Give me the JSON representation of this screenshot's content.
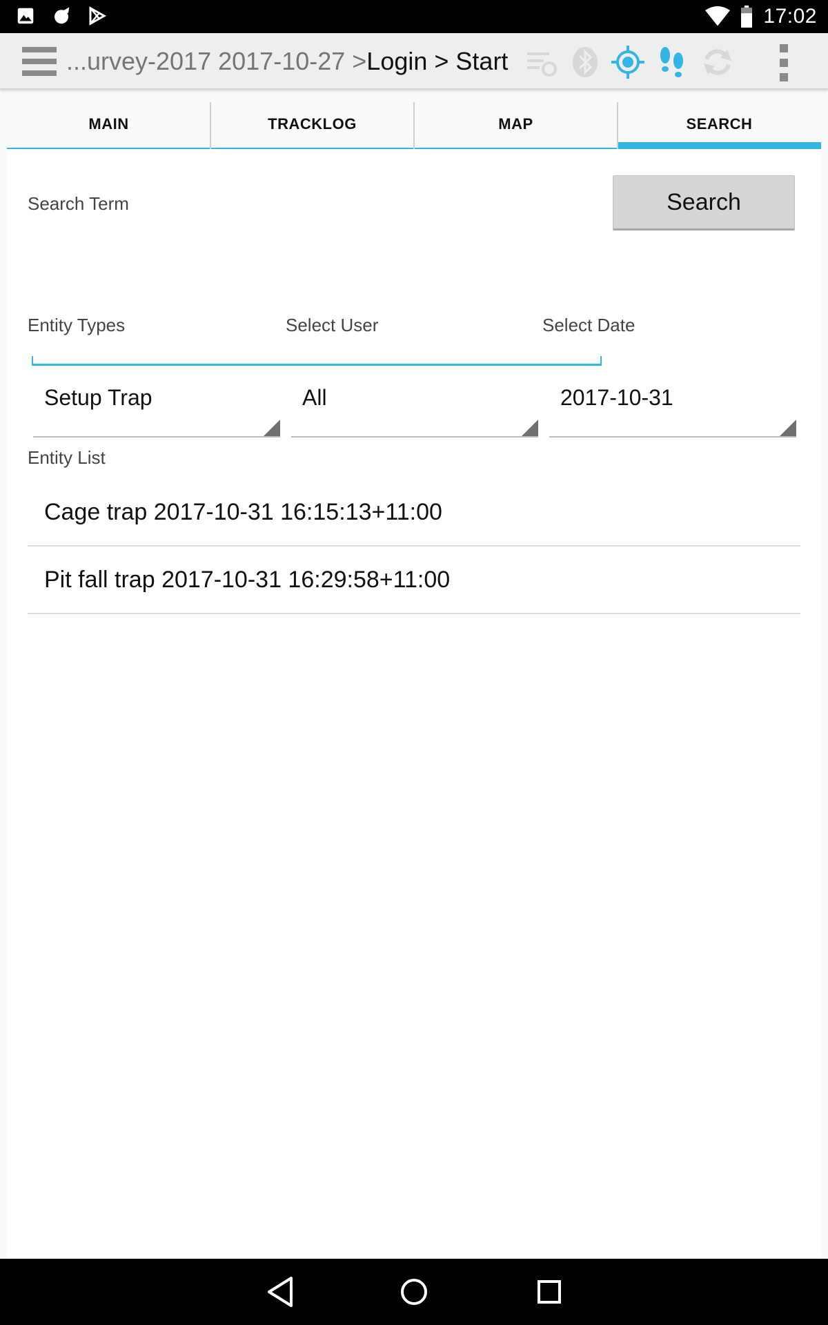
{
  "status_bar": {
    "time": "17:02",
    "left_icons": [
      "image-icon",
      "cat-icon",
      "play-store-icon"
    ],
    "right_icons": [
      "wifi-icon",
      "battery-icon"
    ]
  },
  "action_bar": {
    "breadcrumb_dim": "...urvey-2017 2017-10-27 > ",
    "breadcrumb_main": "Login > Start",
    "icons": [
      "sync-list-icon",
      "bluetooth-icon",
      "gps-icon",
      "tracklog-icon",
      "sync-icon",
      "overflow-menu-icon"
    ],
    "accent": "#33b5e5"
  },
  "tabs": [
    {
      "label": "MAIN",
      "active": false
    },
    {
      "label": "TRACKLOG",
      "active": false
    },
    {
      "label": "MAP",
      "active": false
    },
    {
      "label": "SEARCH",
      "active": true
    }
  ],
  "search": {
    "term_label": "Search Term",
    "button_label": "Search",
    "term_value": ""
  },
  "filters": {
    "entity_types_label": "Entity Types",
    "entity_types_value": "Setup Trap",
    "select_user_label": "Select User",
    "select_user_value": "All",
    "select_date_label": "Select Date",
    "select_date_value": "2017-10-31"
  },
  "entity_list": {
    "label": "Entity List",
    "items": [
      "Cage trap 2017-10-31 16:15:13+11:00",
      "Pit fall trap 2017-10-31 16:29:58+11:00"
    ]
  }
}
